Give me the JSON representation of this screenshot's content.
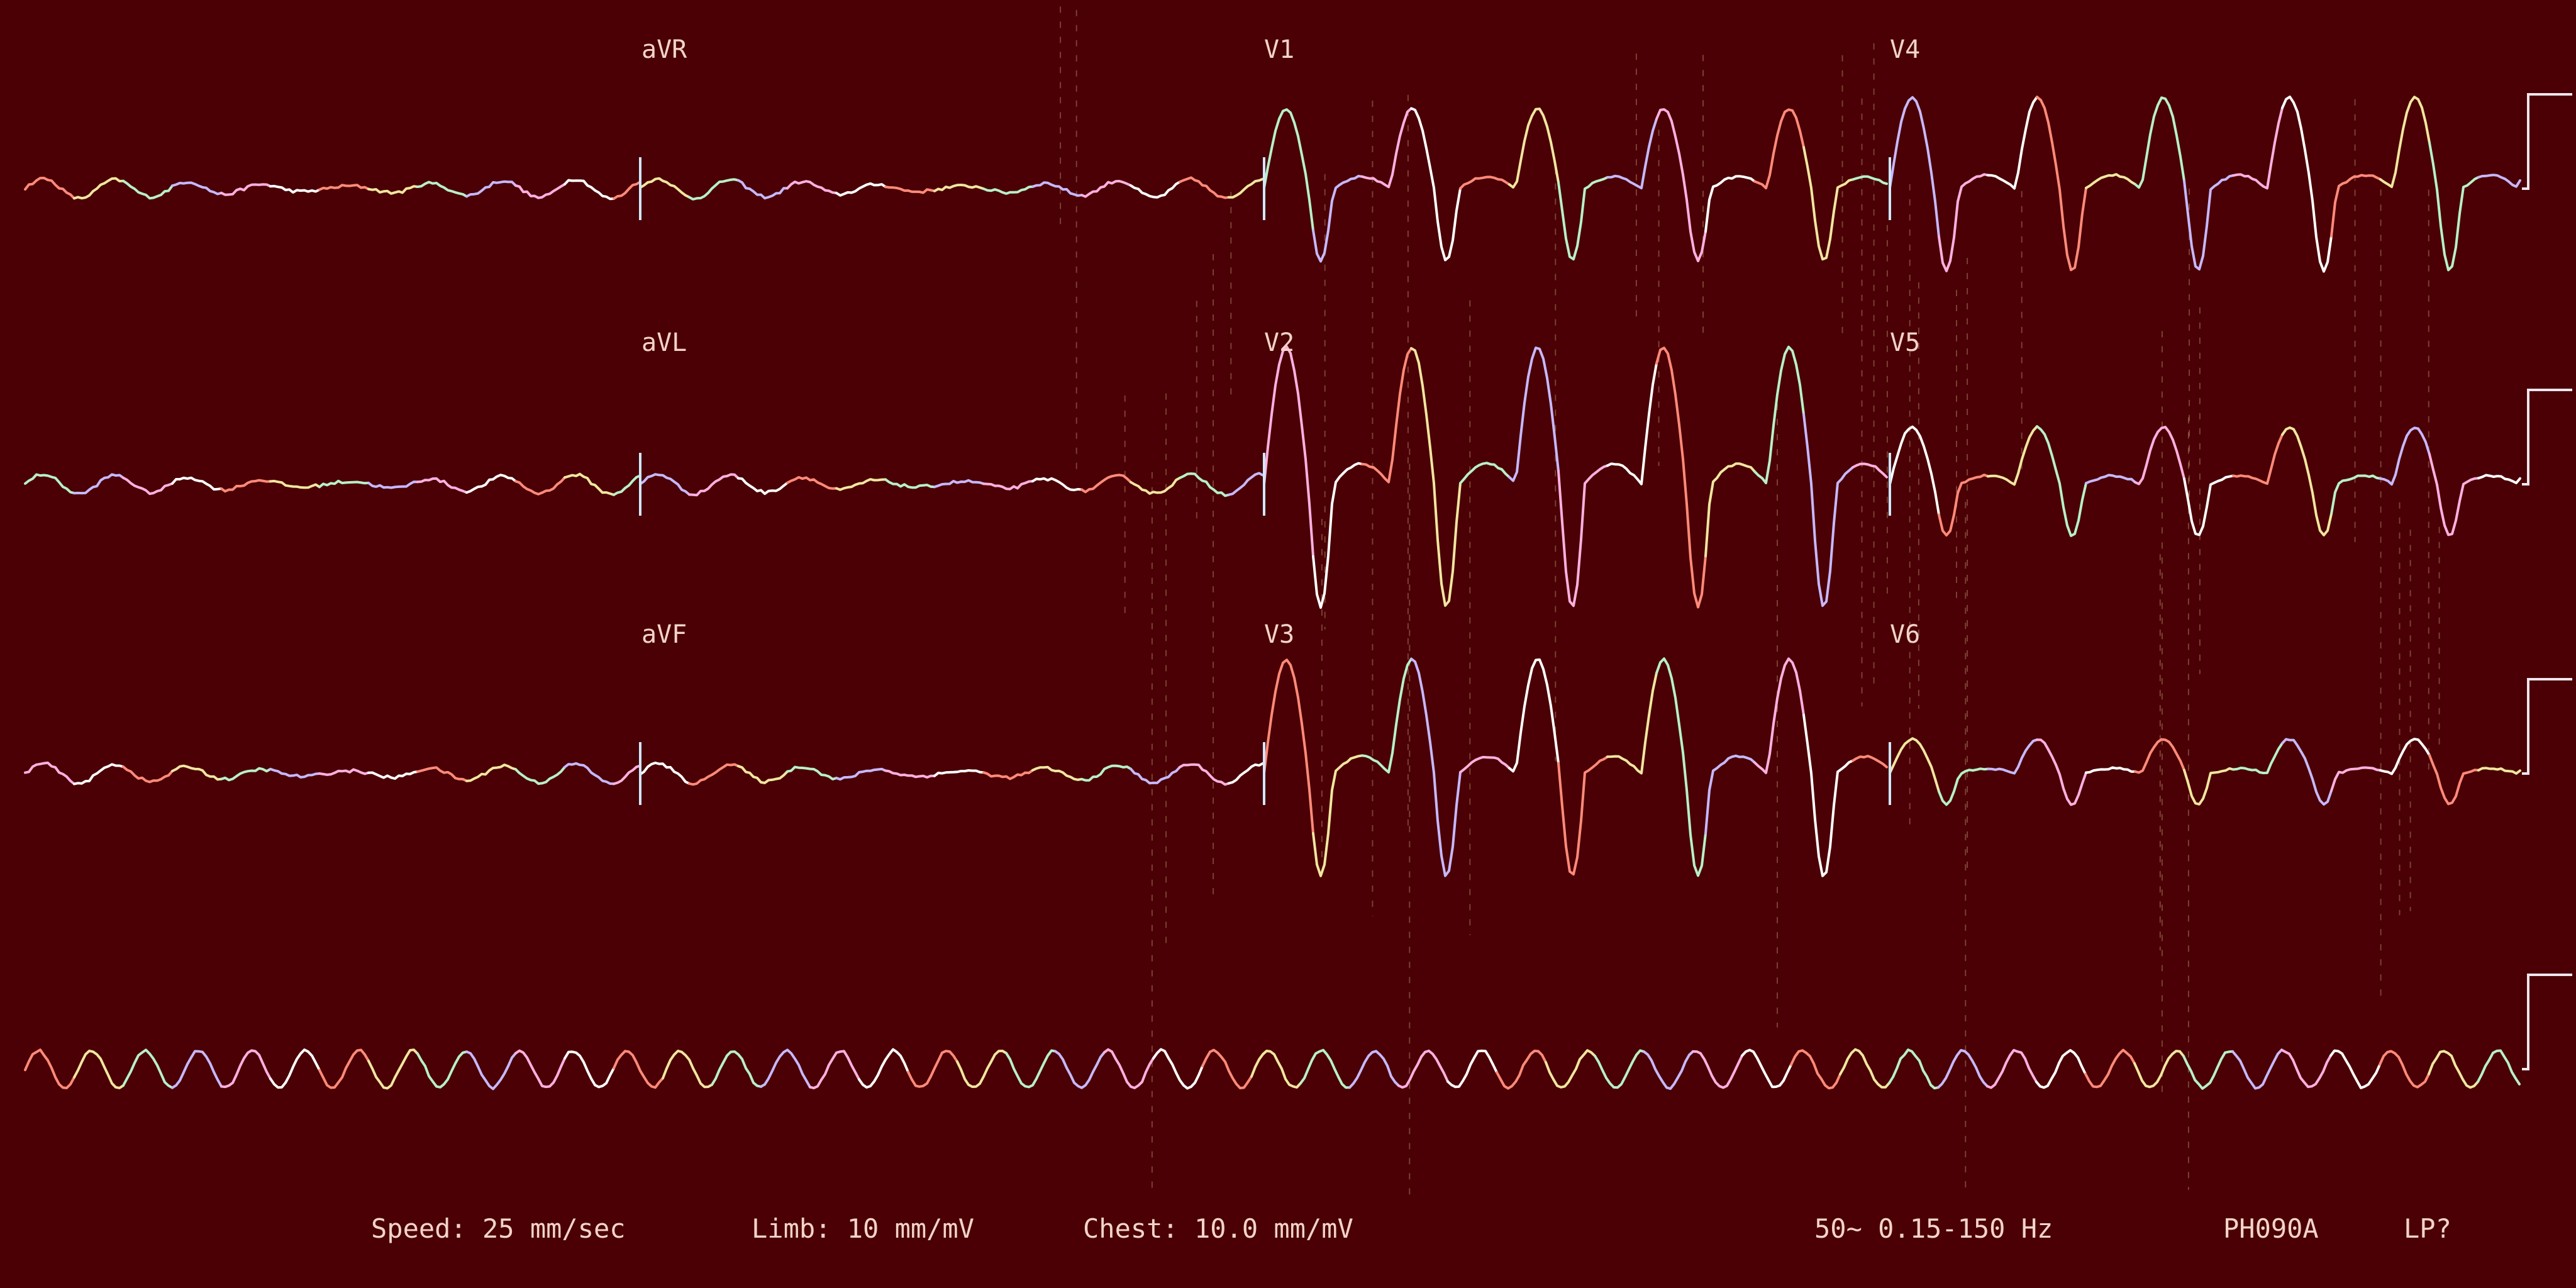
{
  "chart_data": {
    "type": "line",
    "title": "",
    "rows": [
      {
        "leads": [
          {
            "name": "",
            "morphology": "flat"
          },
          {
            "name": "aVR",
            "morphology": "flat"
          },
          {
            "name": "V1",
            "morphology": "wide-qrs",
            "amplitude_mv": 1.4
          },
          {
            "name": "V4",
            "morphology": "wide-qrs",
            "amplitude_mv": 1.6
          }
        ]
      },
      {
        "leads": [
          {
            "name": "",
            "morphology": "flat"
          },
          {
            "name": "aVL",
            "morphology": "flat"
          },
          {
            "name": "V2",
            "morphology": "wide-qrs",
            "amplitude_mv": 2.4
          },
          {
            "name": "V5",
            "morphology": "wide-qrs",
            "amplitude_mv": 1.0
          }
        ]
      },
      {
        "leads": [
          {
            "name": "",
            "morphology": "flat"
          },
          {
            "name": "aVF",
            "morphology": "flat"
          },
          {
            "name": "V3",
            "morphology": "wide-qrs",
            "amplitude_mv": 2.0
          },
          {
            "name": "V6",
            "morphology": "wide-qrs",
            "amplitude_mv": 0.6
          }
        ]
      },
      {
        "leads": [
          {
            "name": "",
            "morphology": "rhythm-strip",
            "amplitude_mv": 0.3
          }
        ]
      }
    ],
    "settings": {
      "speed": "Speed: 25 mm/sec",
      "limb": "Limb: 10 mm/mV",
      "chest": "Chest: 10.0 mm/mV",
      "filter": "50~ 0.15-150 Hz",
      "device": "PH090A",
      "mode": "LP?"
    },
    "colors": {
      "background": "#4a0004",
      "text": "#f4d3c8",
      "trace_palette": [
        "#ff8a7a",
        "#f2e6a0",
        "#b8f0c8",
        "#c7b8ff",
        "#ffb0e0",
        "#ffffff"
      ]
    }
  }
}
